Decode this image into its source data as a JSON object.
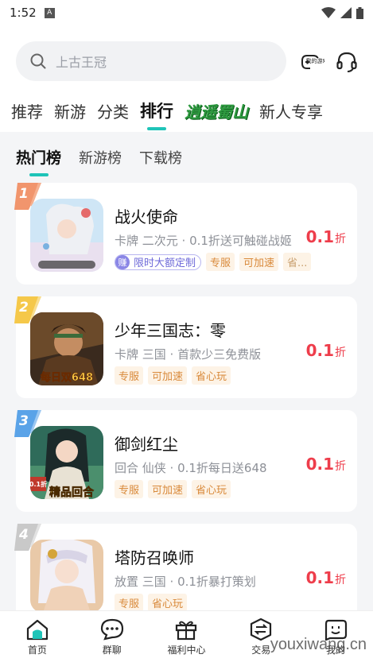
{
  "status": {
    "time": "1:52",
    "app_icon": "A"
  },
  "search": {
    "placeholder": "上古王冠"
  },
  "header": {
    "my_games_label": "我的游戏"
  },
  "tabs": [
    {
      "label": "推荐"
    },
    {
      "label": "新游"
    },
    {
      "label": "分类"
    },
    {
      "label": "排行",
      "active": true
    },
    {
      "label": "逍遥蜀山",
      "special": true
    },
    {
      "label": "新人专享"
    }
  ],
  "subtabs": [
    {
      "label": "热门榜",
      "active": true
    },
    {
      "label": "新游榜"
    },
    {
      "label": "下载榜"
    }
  ],
  "games": [
    {
      "rank": "1",
      "title": "战火使命",
      "desc": "卡牌 二次元 · 0.1折送可触碰战姬",
      "badge_icon": "赚",
      "badge": "限时大额定制",
      "tags": [
        "专服",
        "可加速",
        "省..."
      ],
      "discount": "0.1",
      "discount_unit": "折"
    },
    {
      "rank": "2",
      "title": "少年三国志：零",
      "desc": "卡牌 三国 · 首款少三免费版",
      "tags": [
        "专服",
        "可加速",
        "省心玩"
      ],
      "cover_text": "每日双648",
      "discount": "0.1",
      "discount_unit": "折"
    },
    {
      "rank": "3",
      "title": "御剑红尘",
      "desc": "回合 仙侠 · 0.1折每日送648",
      "tags": [
        "专服",
        "可加速",
        "省心玩"
      ],
      "cover_text": "精品回合",
      "cover_corner": "0.1折",
      "discount": "0.1",
      "discount_unit": "折"
    },
    {
      "rank": "4",
      "title": "塔防召唤师",
      "desc": "放置 三国 · 0.1折暴打策划",
      "tags": [
        "专服",
        "省心玩"
      ],
      "discount": "0.1",
      "discount_unit": "折"
    }
  ],
  "bottom_nav": [
    {
      "label": "首页",
      "icon": "home-icon"
    },
    {
      "label": "群聊",
      "icon": "chat-icon"
    },
    {
      "label": "福利中心",
      "icon": "gift-icon"
    },
    {
      "label": "交易",
      "icon": "exchange-icon"
    },
    {
      "label": "我的",
      "icon": "profile-icon"
    }
  ],
  "watermark": "youxiwang.cn",
  "colors": {
    "accent": "#1fc4b8",
    "discount": "#ee3d4b",
    "tag_text": "#d98a3b",
    "rank1": "#f08a5d",
    "rank2": "#f5c84a",
    "rank3": "#5aa3e8",
    "rank4": "#c9c9c9"
  }
}
